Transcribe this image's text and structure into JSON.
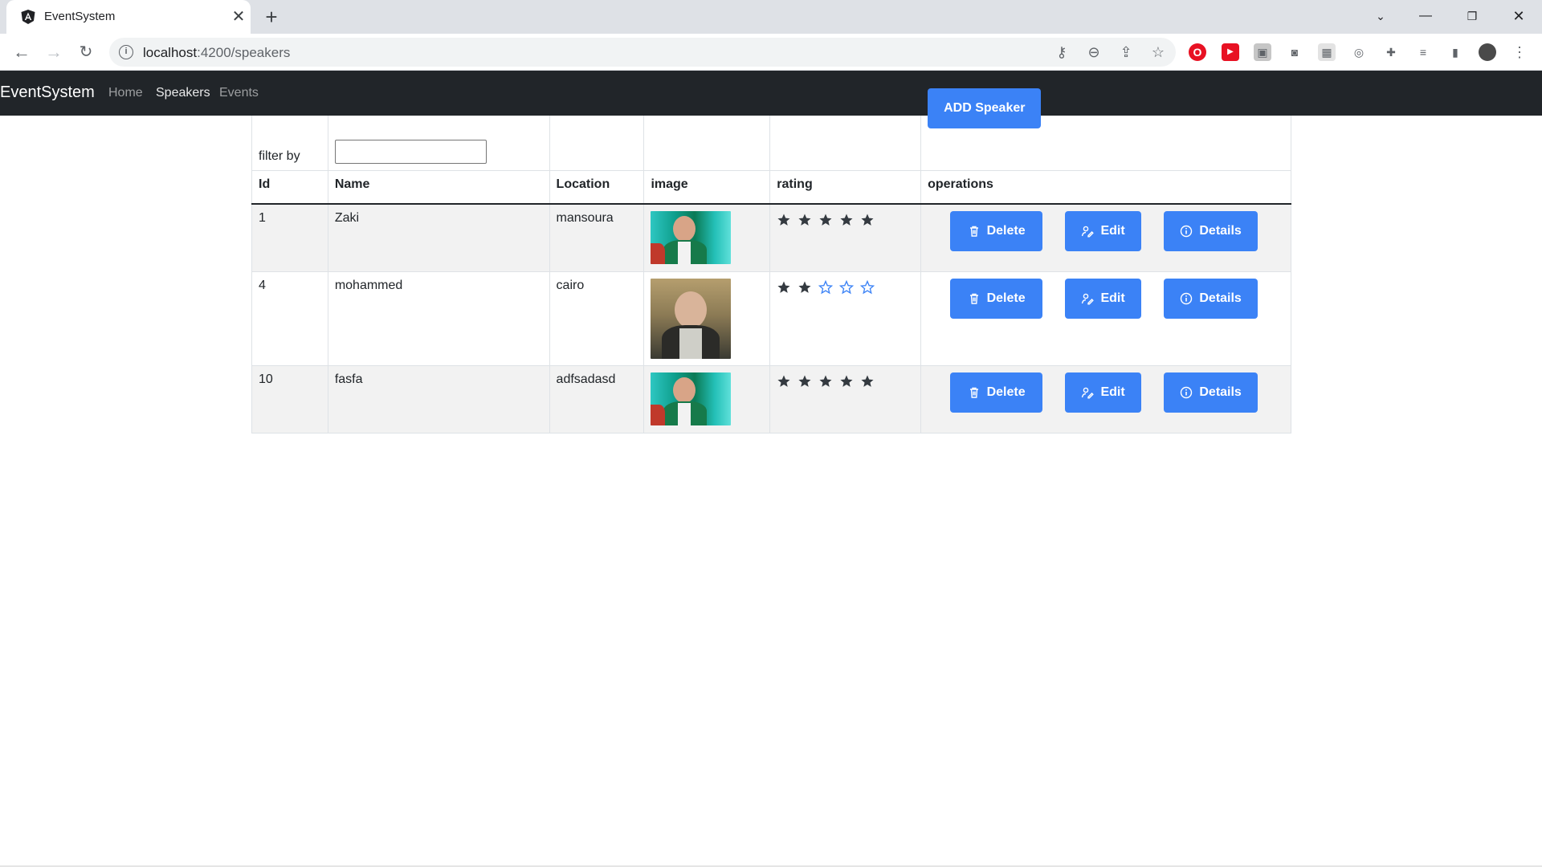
{
  "browser": {
    "tab_title": "EventSystem",
    "url_host": "localhost",
    "url_path": ":4200/speakers"
  },
  "app": {
    "brand": "EventSystem",
    "nav": [
      {
        "label": "Home",
        "active": false
      },
      {
        "label": "Speakers",
        "active": true
      },
      {
        "label": "Events",
        "active": false
      }
    ]
  },
  "toolbar": {
    "filter_label": "filter by",
    "filter_value": "",
    "add_label": "ADD Speaker"
  },
  "table": {
    "headers": [
      "Id",
      "Name",
      "Location",
      "image",
      "rating",
      "operations"
    ],
    "rows": [
      {
        "id": "1",
        "name": "Zaki",
        "location": "mansoura",
        "image": "avatar-a",
        "rating": 5
      },
      {
        "id": "4",
        "name": "mohammed",
        "location": "cairo",
        "image": "avatar-b",
        "rating": 2
      },
      {
        "id": "10",
        "name": "fasfa",
        "location": "adfsadasd",
        "image": "avatar-a",
        "rating": 5
      }
    ],
    "actions": {
      "delete": "Delete",
      "edit": "Edit",
      "details": "Details"
    },
    "rating_max": 5
  },
  "colors": {
    "primary": "#3b82f6",
    "navbar": "#212529",
    "star_filled": "#343a40",
    "star_empty": "#3b82f6"
  }
}
